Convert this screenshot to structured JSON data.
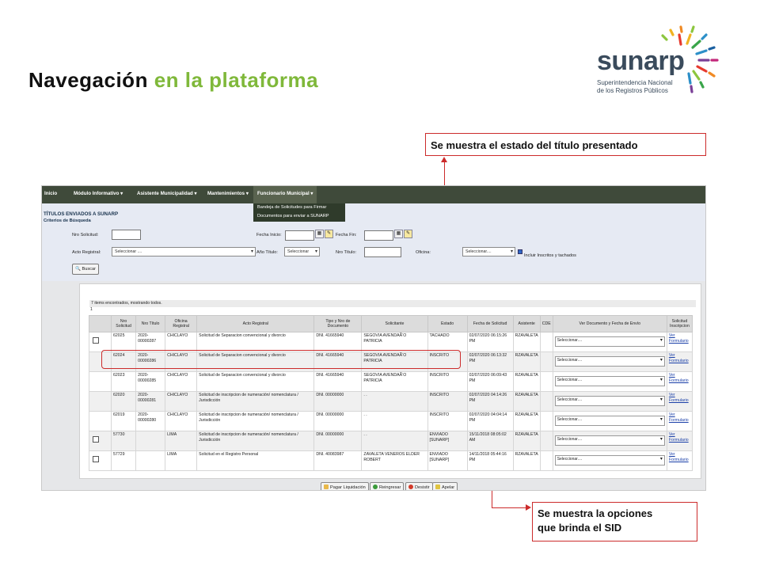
{
  "slide": {
    "title_part1": "Navegación",
    "title_part2": "en la plataforma",
    "logo_word": "sunarp",
    "logo_sub1": "Superintendencia Nacional",
    "logo_sub2": "de los Registros Públicos",
    "callout_top": "Se muestra el estado del título presentado",
    "callout_bottom_line1": "Se muestra la opciones",
    "callout_bottom_line2": "que brinda el SID",
    "colors": {
      "title_green": "#7fb83a",
      "callout_red": "#cc2b2b",
      "menubar": "#3f4a3a"
    }
  },
  "menu": {
    "items": [
      "Inicio",
      "Módulo Informativo ▾",
      "Asistente Municipalidad ▾",
      "Mantenimientos ▾",
      "Funcionario Municipal ▾"
    ],
    "dropdown": [
      "Bandeja de Solicitudes para Firmar",
      "Documentos para enviar a SUNARP"
    ]
  },
  "search": {
    "page_title": "TÍTULOS ENVIADOS A SUNARP",
    "criteria_label": "Criterios de Búsqueda",
    "nro_solicitud_label": "Nro Solicitud:",
    "fecha_inicio_label": "Fecha Inicio:",
    "fecha_fin_label": "Fecha Fin:",
    "acto_registral_label": "Acto Registral:",
    "acto_registral_value": "Seleccionar ....",
    "anio_titulo_label": "Año Título:",
    "anio_titulo_value": "Seleccionar",
    "nro_titulo_label": "Nro Título:",
    "oficina_label": "Oficina:",
    "oficina_value": "Seleccionar....",
    "incluir_label": "Incluir Inscritos y tachados",
    "search_button": "Buscar"
  },
  "results": {
    "found_text": "7 items encontrados, mostrando todos.",
    "page": "1",
    "headers": [
      "",
      "Nro Solicitud",
      "Nro Título",
      "Oficina Registral",
      "Acto Registral",
      "Tipo y Nro de Documento",
      "Solicitante",
      "Estado",
      "Fecha de Solicitud",
      "Asistente",
      "CDE",
      "Ver Documento y Fecha de Envío",
      "Solicitud Inscripcion"
    ],
    "rows": [
      {
        "check": true,
        "nro": "62025",
        "titulo": "2020-00000287",
        "oficina": "CHICLAYO",
        "acto": "Solicitud de Separacion convencional y divorcio",
        "doc": "DNI. 41665940",
        "solicitante": "SEGOVIA AVENDAÃ‘O PATRICIA",
        "estado": "TACHADO",
        "fecha": "02/07/2020 06:15:26 PM",
        "asistente": "RZAVALETA",
        "cde": "",
        "ver": "Seleccionar....",
        "link1": "Ver",
        "link2": "Formulario"
      },
      {
        "check": false,
        "nro": "62024",
        "titulo": "2020-00000286",
        "oficina": "CHICLAYO",
        "acto": "Solicitud de Separacion convencional y divorcio",
        "doc": "DNI. 41665940",
        "solicitante": "SEGOVIA AVENDAÃ‘O PATRICIA",
        "estado": "INSCRITO",
        "fecha": "02/07/2020 06:13:32 PM",
        "asistente": "RZAVALETA",
        "cde": "",
        "ver": "Seleccionar....",
        "link1": "Ver",
        "link2": "Formulario"
      },
      {
        "check": false,
        "nro": "62023",
        "titulo": "2020-00000285",
        "oficina": "CHICLAYO",
        "acto": "Solicitud de Separacion convencional y divorcio",
        "doc": "DNI. 41665940",
        "solicitante": "SEGOVIA AVENDAÃ‘O PATRICIA",
        "estado": "INSCRITO",
        "fecha": "02/07/2020 06:09:43 PM",
        "asistente": "RZAVALETA",
        "cde": "",
        "ver": "Seleccionar....",
        "link1": "Ver",
        "link2": "Formulario"
      },
      {
        "check": false,
        "nro": "62020",
        "titulo": "2020-00000281",
        "oficina": "CHICLAYO",
        "acto": "Solicitud de inscripcion de numeración/ nomenclatura / Jurisdicción",
        "doc": "DNI. 00000000",
        "solicitante": ". .",
        "estado": "INSCRITO",
        "fecha": "02/07/2020 04:14:26 PM",
        "asistente": "RZAVALETA",
        "cde": "",
        "ver": "Seleccionar....",
        "link1": "Ver",
        "link2": "Formulario"
      },
      {
        "check": false,
        "nro": "62019",
        "titulo": "2020-00000280",
        "oficina": "CHICLAYO",
        "acto": "Solicitud de inscripcion de numeración/ nomenclatura / Jurisdicción",
        "doc": "DNI. 00000000",
        "solicitante": ". .",
        "estado": "INSCRITO",
        "fecha": "02/07/2020 04:04:14 PM",
        "asistente": "RZAVALETA",
        "cde": "",
        "ver": "Seleccionar....",
        "link1": "Ver",
        "link2": "Formulario"
      },
      {
        "check": true,
        "nro": "57730",
        "titulo": "",
        "oficina": "LIMA",
        "acto": "Solicitud de inscripcion de numeración/ nomenclatura / Jurisdicción",
        "doc": "DNI. 00000000",
        "solicitante": ". .",
        "estado": "ENVIADO [SUNARP]",
        "fecha": "15/11/2018 08:05:02 AM",
        "asistente": "RZAVALETA",
        "cde": "",
        "ver": "Seleccionar....",
        "link1": "Ver",
        "link2": "Formulario"
      },
      {
        "check": true,
        "nro": "57729",
        "titulo": "",
        "oficina": "LIMA",
        "acto": "Solicitud en el Registro Personal",
        "doc": "DNI. 40083987",
        "solicitante": "ZAVALETA VENEROS ELDER ROBERT",
        "estado": "ENVIADO [SUNARP]",
        "fecha": "14/11/2018 05:44:16 PM",
        "asistente": "RZAVALETA",
        "cde": "",
        "ver": "Seleccionar....",
        "link1": "Ver",
        "link2": "Formulario"
      }
    ]
  },
  "actions": [
    "Pagar Liquidación",
    "Reingresar",
    "Desistir",
    "Apelar"
  ]
}
